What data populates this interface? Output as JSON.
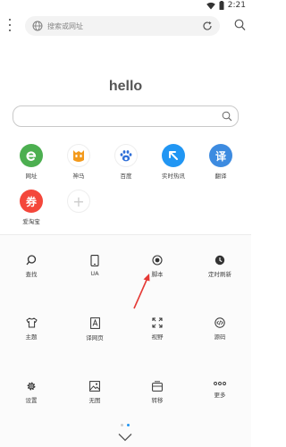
{
  "status_bar": {
    "time": "2:21"
  },
  "url_bar": {
    "placeholder": "搜索或网址"
  },
  "home": {
    "greeting": "hello",
    "search_value": ""
  },
  "shortcuts": [
    {
      "label": "网址",
      "glyph": "e",
      "color": "#4caf50",
      "icon": "browser-e-icon"
    },
    {
      "label": "神马",
      "glyph": "",
      "color": "#ffffff",
      "icon": "shenma-logo-icon"
    },
    {
      "label": "百度",
      "glyph": "",
      "color": "#ffffff",
      "icon": "baidu-paw-icon"
    },
    {
      "label": "实时热讯",
      "glyph": "↖",
      "color": "#2196f3",
      "icon": "hot-news-icon"
    },
    {
      "label": "翻译",
      "glyph": "译",
      "color": "#3d8be0",
      "icon": "translate-icon"
    },
    {
      "label": "爱淘宝",
      "glyph": "券",
      "color": "#f4473b",
      "icon": "coupon-icon"
    },
    {
      "label": "",
      "glyph": "+",
      "color": "#ffffff",
      "icon": "add-shortcut-icon"
    }
  ],
  "tools": [
    {
      "label": "查找",
      "icon": "find-icon"
    },
    {
      "label": "UA",
      "icon": "user-agent-icon"
    },
    {
      "label": "脚本",
      "icon": "script-icon"
    },
    {
      "label": "定时刷新",
      "icon": "timer-refresh-icon"
    },
    {
      "label": "主题",
      "icon": "theme-shirt-icon"
    },
    {
      "label": "译网页",
      "icon": "translate-page-icon"
    },
    {
      "label": "视野",
      "icon": "fullscreen-icon"
    },
    {
      "label": "源码",
      "icon": "source-code-icon"
    },
    {
      "label": "设置",
      "icon": "settings-gear-icon"
    },
    {
      "label": "无图",
      "icon": "no-image-icon"
    },
    {
      "label": "转移",
      "icon": "transfer-icon"
    },
    {
      "label": "更多",
      "icon": "more-icon"
    }
  ],
  "colors": {
    "accent": "#2196f3",
    "annotation_arrow": "#e53935"
  }
}
